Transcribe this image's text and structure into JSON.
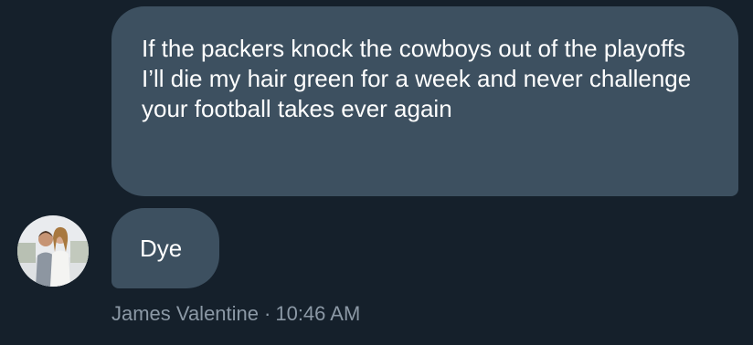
{
  "conversation": {
    "sent_message": "If the packers knock the cowboys out of the playoffs I’ll die my hair green for a week and never challenge your football takes ever again",
    "received_message": "Dye",
    "sender_name": "James Valentine",
    "separator": "·",
    "timestamp": "10:46 AM"
  },
  "colors": {
    "background": "#15202b",
    "bubble": "#3d5060",
    "message_text": "#ffffff",
    "meta_text": "#8b98a5"
  },
  "icons": {
    "avatar": "user-avatar-photo"
  }
}
